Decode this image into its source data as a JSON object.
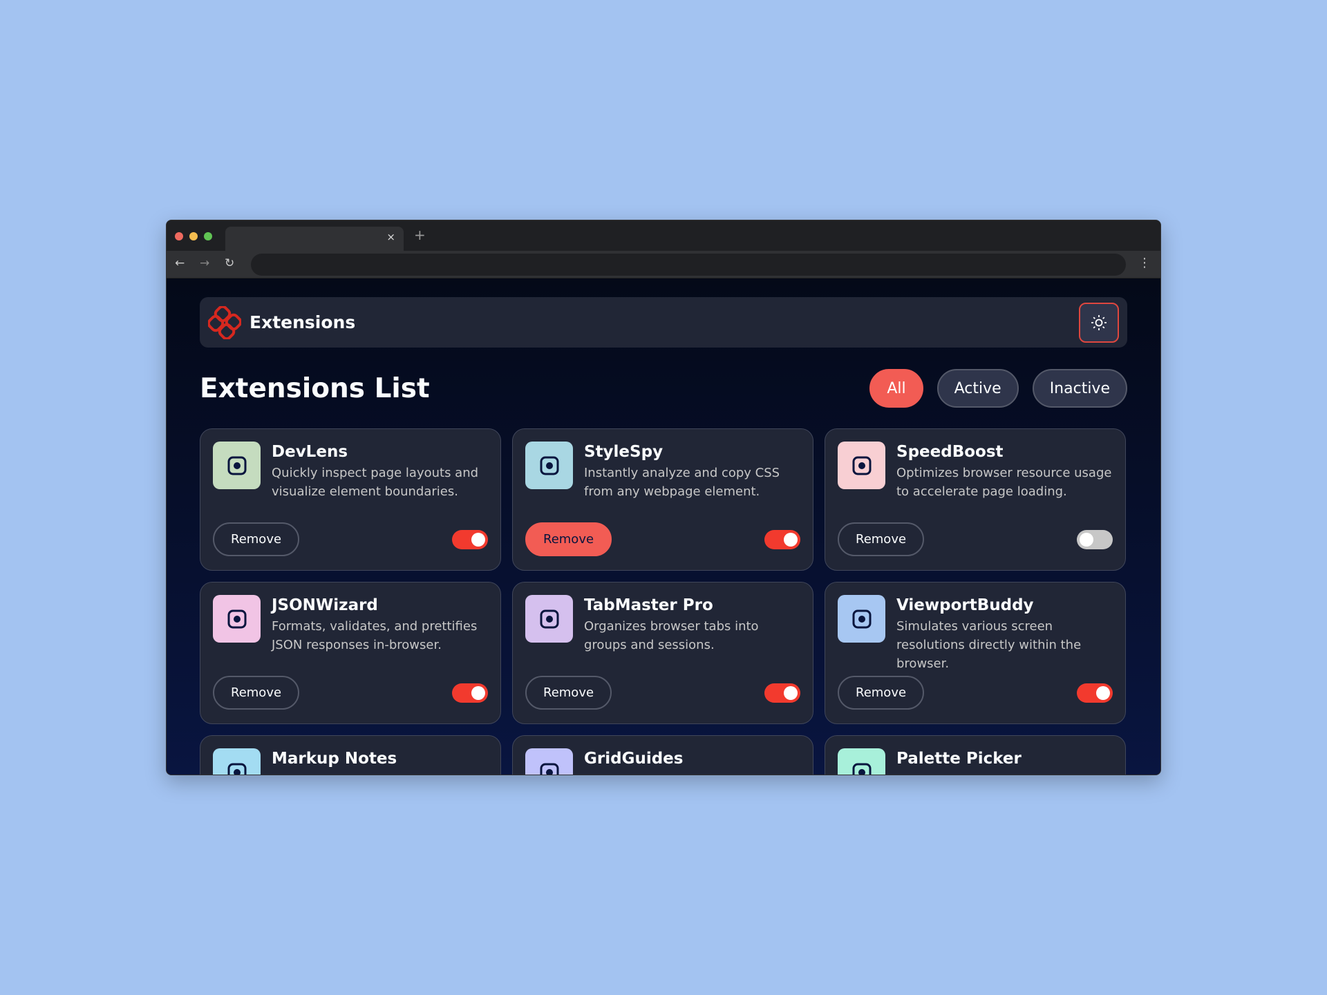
{
  "app": {
    "title": "Extensions",
    "theme_icon": "sun-icon",
    "accent": "#f25c54"
  },
  "page": {
    "title": "Extensions List",
    "filters": [
      "All",
      "Active",
      "Inactive"
    ],
    "selected_filter": "All"
  },
  "browser": {
    "tab_close": "×",
    "new_tab": "+",
    "back": "←",
    "forward": "→",
    "reload": "↻",
    "menu": "⋮"
  },
  "remove_label": "Remove",
  "extensions": [
    {
      "name": "DevLens",
      "description": "Quickly inspect page layouts and visualize element boundaries.",
      "active": true,
      "icon": "browser-search-icon",
      "color": "#c5dcbf"
    },
    {
      "name": "StyleSpy",
      "description": "Instantly analyze and copy CSS from any webpage element.",
      "active": true,
      "icon": "brackets-icon",
      "color": "#a9d7e3"
    },
    {
      "name": "SpeedBoost",
      "description": "Optimizes browser resource usage to accelerate page loading.",
      "active": false,
      "icon": "speed-icon",
      "color": "#f8cfd3"
    },
    {
      "name": "JSONWizard",
      "description": "Formats, validates, and prettifies JSON responses in-browser.",
      "active": true,
      "icon": "wand-icon",
      "color": "#f1c4e5"
    },
    {
      "name": "TabMaster Pro",
      "description": "Organizes browser tabs into groups and sessions.",
      "active": true,
      "icon": "jar-icon",
      "color": "#d5c0ee"
    },
    {
      "name": "ViewportBuddy",
      "description": "Simulates various screen resolutions directly within the browser.",
      "active": true,
      "icon": "resize-icon",
      "color": "#a7c7f2"
    },
    {
      "name": "Markup Notes",
      "description": "",
      "active": true,
      "icon": "note-icon",
      "color": "#a3dcf2"
    },
    {
      "name": "GridGuides",
      "description": "",
      "active": true,
      "icon": "grid-icon",
      "color": "#c0c2fb"
    },
    {
      "name": "Palette Picker",
      "description": "",
      "active": true,
      "icon": "palette-icon",
      "color": "#a8f0da"
    }
  ]
}
